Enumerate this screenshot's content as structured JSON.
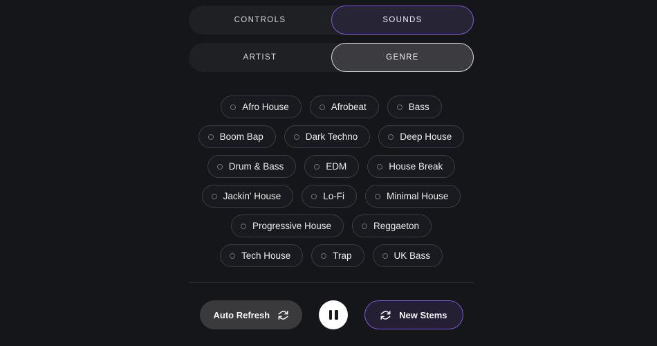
{
  "theme": {
    "background": "#14161a",
    "accent_purple": "#8257d6",
    "pill_border": "#3a3d45",
    "tab_track": "#1e2024",
    "text_primary": "#ececed"
  },
  "tab_rows": [
    {
      "name": "primary-tabs",
      "tabs": [
        {
          "label": "CONTROLS",
          "state": "inactive"
        },
        {
          "label": "SOUNDS",
          "state": "active-purple"
        }
      ]
    },
    {
      "name": "secondary-tabs",
      "tabs": [
        {
          "label": "ARTIST",
          "state": "inactive"
        },
        {
          "label": "GENRE",
          "state": "active-gray"
        }
      ]
    }
  ],
  "genres": [
    {
      "label": "Afro House",
      "selected": false
    },
    {
      "label": "Afrobeat",
      "selected": false
    },
    {
      "label": "Bass",
      "selected": false
    },
    {
      "label": "Boom Bap",
      "selected": false
    },
    {
      "label": "Dark Techno",
      "selected": false
    },
    {
      "label": "Deep House",
      "selected": false
    },
    {
      "label": "Drum & Bass",
      "selected": false
    },
    {
      "label": "EDM",
      "selected": false
    },
    {
      "label": "House Break",
      "selected": false
    },
    {
      "label": "Jackin' House",
      "selected": false
    },
    {
      "label": "Lo-Fi",
      "selected": false
    },
    {
      "label": "Minimal House",
      "selected": false
    },
    {
      "label": "Progressive House",
      "selected": false
    },
    {
      "label": "Reggaeton",
      "selected": false
    },
    {
      "label": "Tech House",
      "selected": false
    },
    {
      "label": "Trap",
      "selected": false
    },
    {
      "label": "UK Bass",
      "selected": false
    }
  ],
  "controls": {
    "auto_refresh": {
      "label": "Auto Refresh",
      "icon": "refresh-icon"
    },
    "transport": {
      "state": "playing",
      "icon": "pause-icon"
    },
    "new_stems": {
      "label": "New Stems",
      "icon": "refresh-icon"
    }
  }
}
